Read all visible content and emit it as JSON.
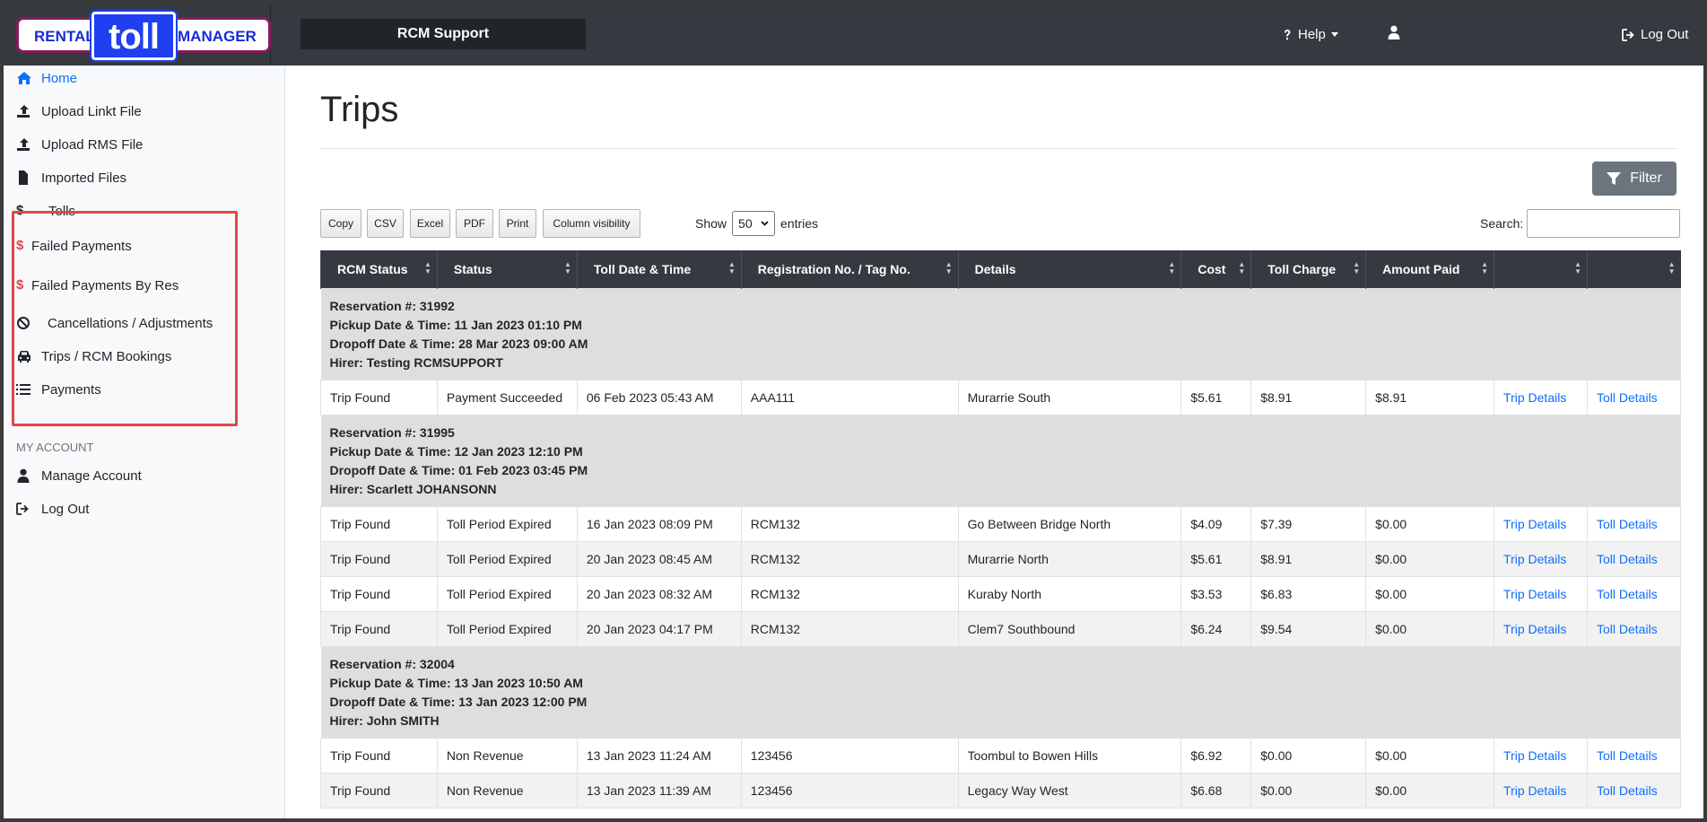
{
  "brand": {
    "left": "RENTAL",
    "middle": "toll",
    "right": "MANAGER"
  },
  "topbar": {
    "support": "RCM Support",
    "help": "Help",
    "logout": "Log Out"
  },
  "sidebar": {
    "items": [
      {
        "label": "Home",
        "icon": "home-icon"
      },
      {
        "label": "Upload Linkt File",
        "icon": "upload-icon"
      },
      {
        "label": "Upload RMS File",
        "icon": "upload-icon"
      },
      {
        "label": "Imported Files",
        "icon": "file-icon"
      },
      {
        "label": "Tolls",
        "icon": "dollar-icon"
      },
      {
        "label": "Failed Payments",
        "icon": "dollar-icon"
      },
      {
        "label": "Failed Payments By Res",
        "icon": "dollar-icon"
      },
      {
        "label": "Cancellations / Adjustments",
        "icon": "ban-icon"
      },
      {
        "label": "Trips / RCM Bookings",
        "icon": "car-icon"
      },
      {
        "label": "Payments",
        "icon": "list-icon"
      }
    ],
    "account_heading": "MY ACCOUNT",
    "account_items": [
      {
        "label": "Manage Account",
        "icon": "user-icon"
      },
      {
        "label": "Log Out",
        "icon": "logout-icon"
      }
    ],
    "accent": "#0d6efd",
    "highlight_color": "#e0474c"
  },
  "main": {
    "title": "Trips",
    "filter_label": "Filter",
    "buttons": [
      "Copy",
      "CSV",
      "Excel",
      "PDF",
      "Print",
      "Column visibility"
    ],
    "show_label": "Show",
    "entries_value": "50",
    "entries_label": "entries",
    "search_label": "Search:",
    "search_value": ""
  },
  "table": {
    "headers": [
      "RCM Status",
      "Status",
      "Toll Date & Time",
      "Registration No. / Tag No.",
      "Details",
      "Cost",
      "Toll Charge",
      "Amount Paid",
      "",
      ""
    ],
    "groups": [
      {
        "reservation": "Reservation #: 31992",
        "pickup": "Pickup Date & Time: 11 Jan 2023 01:10 PM",
        "dropoff": "Dropoff Date & Time: 28 Mar 2023 09:00 AM",
        "hirer": "Hirer: Testing RCMSUPPORT",
        "rows": [
          [
            "Trip Found",
            "Payment Succeeded",
            "06 Feb 2023 05:43 AM",
            "AAA111",
            "Murarrie South",
            "$5.61",
            "$8.91",
            "$8.91",
            "Trip Details",
            "Toll Details"
          ]
        ]
      },
      {
        "reservation": "Reservation #: 31995",
        "pickup": "Pickup Date & Time: 12 Jan 2023 12:10 PM",
        "dropoff": "Dropoff Date & Time: 01 Feb 2023 03:45 PM",
        "hirer": "Hirer: Scarlett JOHANSONN",
        "rows": [
          [
            "Trip Found",
            "Toll Period Expired",
            "16 Jan 2023 08:09 PM",
            "RCM132",
            "Go Between Bridge North",
            "$4.09",
            "$7.39",
            "$0.00",
            "Trip Details",
            "Toll Details"
          ],
          [
            "Trip Found",
            "Toll Period Expired",
            "20 Jan 2023 08:45 AM",
            "RCM132",
            "Murarrie North",
            "$5.61",
            "$8.91",
            "$0.00",
            "Trip Details",
            "Toll Details"
          ],
          [
            "Trip Found",
            "Toll Period Expired",
            "20 Jan 2023 08:32 AM",
            "RCM132",
            "Kuraby North",
            "$3.53",
            "$6.83",
            "$0.00",
            "Trip Details",
            "Toll Details"
          ],
          [
            "Trip Found",
            "Toll Period Expired",
            "20 Jan 2023 04:17 PM",
            "RCM132",
            "Clem7 Southbound",
            "$6.24",
            "$9.54",
            "$0.00",
            "Trip Details",
            "Toll Details"
          ]
        ]
      },
      {
        "reservation": "Reservation #: 32004",
        "pickup": "Pickup Date & Time: 13 Jan 2023 10:50 AM",
        "dropoff": "Dropoff Date & Time: 13 Jan 2023 12:00 PM",
        "hirer": "Hirer: John SMITH",
        "rows": [
          [
            "Trip Found",
            "Non Revenue",
            "13 Jan 2023 11:24 AM",
            "123456",
            "Toombul to Bowen Hills",
            "$6.92",
            "$0.00",
            "$0.00",
            "Trip Details",
            "Toll Details"
          ],
          [
            "Trip Found",
            "Non Revenue",
            "13 Jan 2023 11:39 AM",
            "123456",
            "Legacy Way West",
            "$6.68",
            "$0.00",
            "$0.00",
            "Trip Details",
            "Toll Details"
          ]
        ]
      }
    ]
  }
}
